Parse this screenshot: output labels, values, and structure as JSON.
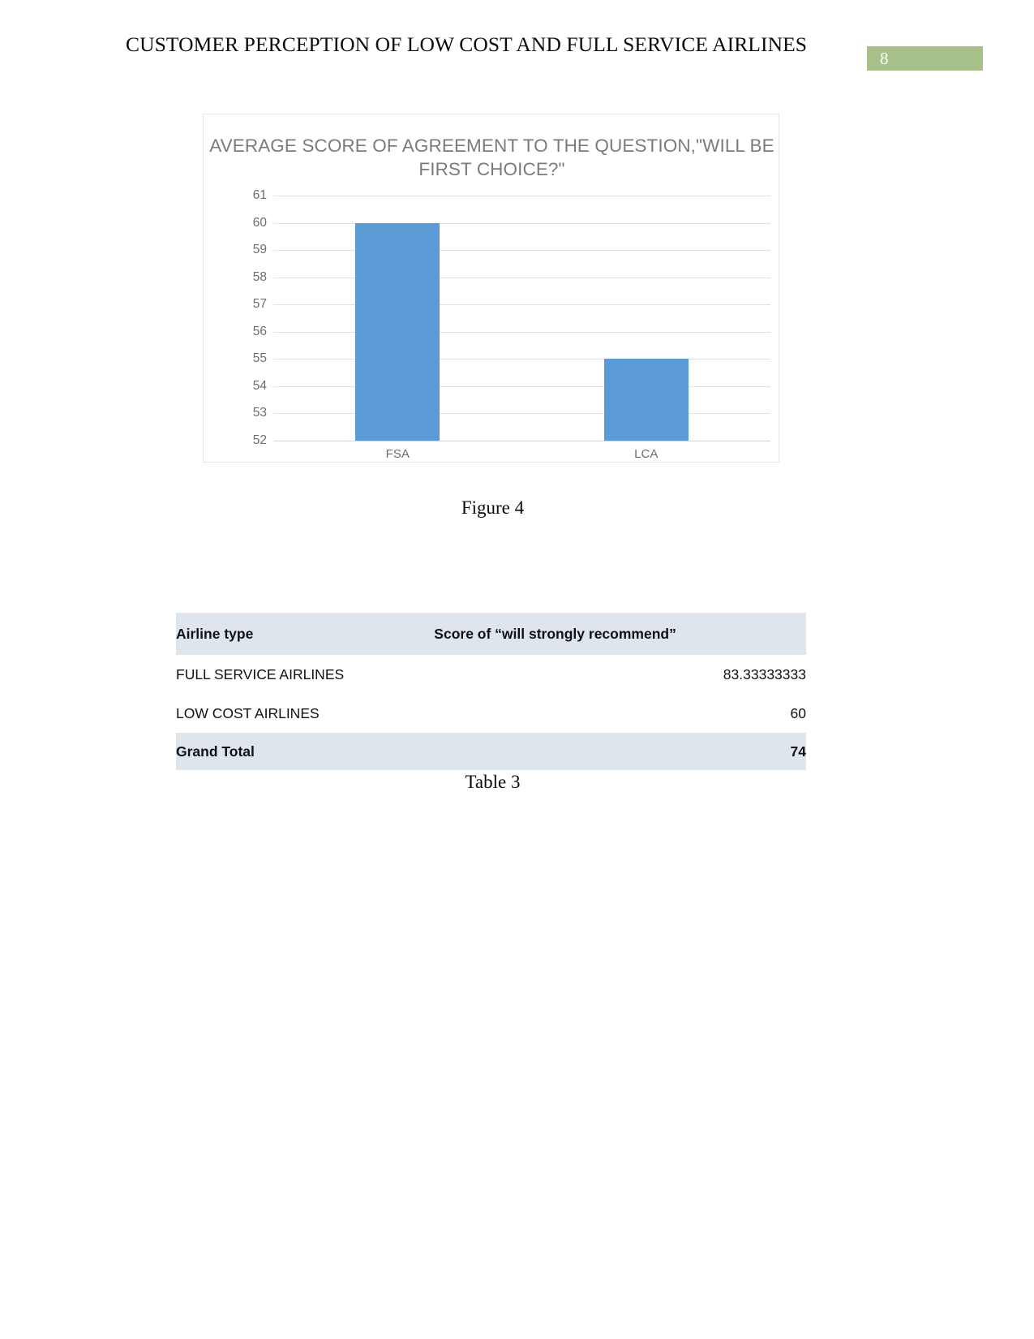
{
  "header": {
    "title": "CUSTOMER PERCEPTION OF LOW COST AND FULL SERVICE AIRLINES",
    "page_number": "8",
    "page_number_bg": "#a8c18a"
  },
  "figure": {
    "caption": "Figure 4"
  },
  "table_caption": {
    "caption": "Table 3"
  },
  "table": {
    "headers": [
      "Airline type",
      "Score of “will strongly recommend”"
    ],
    "rows": [
      {
        "label": "FULL SERVICE AIRLINES",
        "value": "83.33333333"
      },
      {
        "label": "LOW COST AIRLINES",
        "value": "60"
      },
      {
        "label": "Grand Total",
        "value": "74"
      }
    ],
    "header_bg": "#dee5ed",
    "total_bg": "#dee5ed"
  },
  "chart_data": {
    "type": "bar",
    "title": "AVERAGE SCORE OF AGREEMENT TO THE QUESTION,\"WILL BE FIRST CHOICE?\"",
    "categories": [
      "FSA",
      "LCA"
    ],
    "values": [
      60,
      55
    ],
    "xlabel": "",
    "ylabel": "",
    "ylim": [
      52,
      61
    ],
    "yticks": [
      61,
      60,
      59,
      58,
      57,
      56,
      55,
      54,
      53,
      52
    ],
    "ytick_labels": [
      "61",
      "60",
      "59",
      "58",
      "57",
      "56",
      "55",
      "54",
      "53",
      "52"
    ],
    "grid": true,
    "legend": false,
    "bar_color": "#5b9bd5",
    "plot_bg": "#ffffff",
    "gridline_color": "#e2e2e2",
    "tick_label_color": "#6d6d6d",
    "title_color": "#7b7b7b"
  }
}
